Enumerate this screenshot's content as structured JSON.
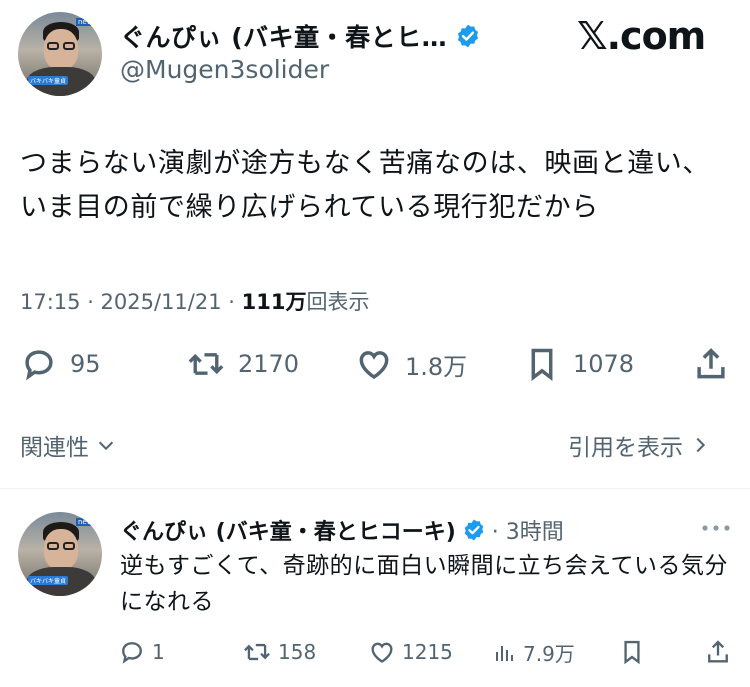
{
  "tweet": {
    "display_name": "ぐんぴぃ (バキ童・春とヒ…",
    "handle": "@Mugen3solider",
    "site_logo": "𝕏.com",
    "text": "つまらない演劇が途方もなく苦痛なのは、映画と違い、いま目の前で繰り広げられている現行犯だから",
    "time": "17:15 · 2025/11/21 · ",
    "views_count": "111万",
    "views_label": "回表示",
    "replies": "95",
    "retweets": "2170",
    "likes": "1.8万",
    "bookmarks": "1078",
    "related_label": "関連性",
    "quotes_label": "引用を表示",
    "verified_color": "#1d9bf0"
  },
  "reply": {
    "display_name": "ぐんぴぃ (バキ童・春とヒコーキ)",
    "time": "· 3時間",
    "text": "逆もすごくて、奇跡的に面白い瞬間に立ち会えている気分になれる",
    "replies": "1",
    "retweets": "158",
    "likes": "1215",
    "views": "7.9万"
  },
  "avatar": {
    "banner_text": "news",
    "sign_text": "バキバキ童貞"
  },
  "icons": [
    "verified-badge-icon",
    "reply-icon",
    "retweet-icon",
    "like-icon",
    "bookmark-icon",
    "share-icon",
    "chevron-down-icon",
    "chevron-right-icon",
    "more-icon",
    "views-icon"
  ]
}
